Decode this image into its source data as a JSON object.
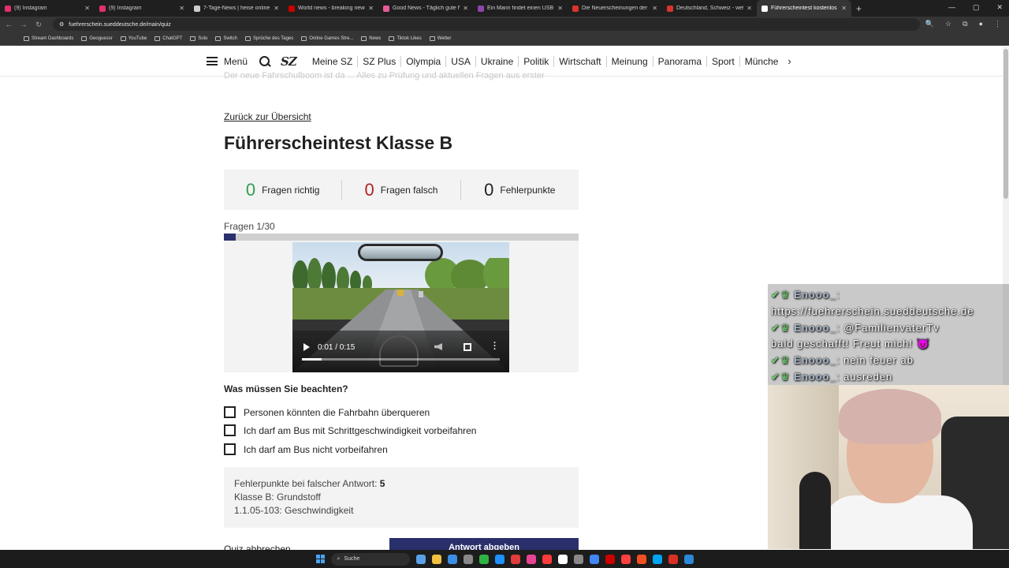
{
  "browser": {
    "tabs": [
      {
        "label": "(9) Instagram",
        "color": "#e1306c"
      },
      {
        "label": "(9) Instagram",
        "color": "#e1306c"
      },
      {
        "label": "7-Tage-News | heise online",
        "color": "#cccccc"
      },
      {
        "label": "World news - breaking news, vi",
        "color": "#cc0000"
      },
      {
        "label": "Good News - Täglich gute Nach",
        "color": "#e85a9a"
      },
      {
        "label": "Ein Mann findet einen USB-Stic",
        "color": "#8e44ad"
      },
      {
        "label": "Die Neuerscheinungen der Wo",
        "color": "#d9342b"
      },
      {
        "label": "Deutschland, Schweiz - wetter.",
        "color": "#d9342b"
      },
      {
        "label": "Führerscheintest kostenlos onli",
        "color": "#ffffff"
      }
    ],
    "active_tab_index": 8,
    "new_tab": "+",
    "url": "fuehrerschein.sueddeutsche.de/main/quiz",
    "bookmarks": [
      "Stream Dashboards",
      "Geoguessr",
      "YouTube",
      "ChatGPT",
      "Solo",
      "Switch",
      "Sprüche des Tages",
      "Online Games Stre...",
      "News",
      "Tiktok Likes",
      "Wetter"
    ]
  },
  "sz_nav": {
    "menu_label": "Menü",
    "logo": "SZ",
    "links": [
      "Meine SZ",
      "SZ Plus",
      "Olympia",
      "USA",
      "Ukraine",
      "Politik",
      "Wirtschaft",
      "Meinung",
      "Panorama",
      "Sport",
      "Münche"
    ]
  },
  "quiz": {
    "cutoff_text": "Der neue Fahrschulboom ist da ... Alles zu Prüfung und aktuellen Fragen aus erster",
    "back_link": "Zurück zur Übersicht",
    "title": "Führerscheintest Klasse B",
    "score": {
      "correct_value": "0",
      "correct_label": "Fragen richtig",
      "correct_color": "#2e9e4f",
      "wrong_value": "0",
      "wrong_label": "Fragen falsch",
      "wrong_color": "#b22222",
      "points_value": "0",
      "points_label": "Fehlerpunkte",
      "points_color": "#222222"
    },
    "progress_label": "Fragen 1/30",
    "progress_fraction": 0.0333,
    "video": {
      "time": "0:01 / 0:15",
      "played_fraction": 0.1
    },
    "question": "Was müssen Sie beachten?",
    "answers": [
      "Personen könnten die Fahrbahn überqueren",
      "Ich darf am Bus mit Schrittgeschwindigkeit vorbeifahren",
      "Ich darf am Bus nicht vorbeifahren"
    ],
    "info": {
      "points_prefix": "Fehlerpunkte bei falscher Antwort: ",
      "points_value": "5",
      "class_line": "Klasse B: Grundstoff",
      "code_line": "1.1.05-103: Geschwindigkeit"
    },
    "abort_label": "Quiz abbrechen",
    "submit_label": "Antwort abgeben"
  },
  "chat": {
    "lines": [
      {
        "user": "Enooo_",
        "text": ":"
      },
      {
        "user": "",
        "text": "https://fuehrerschein.sueddeutsche.de"
      },
      {
        "user": "Enooo_",
        "text": ": @FamilienvaterTv"
      },
      {
        "user": "",
        "text": "bald geschafft! Freut mich! 😈"
      },
      {
        "user": "Enooo_",
        "text": ": nein feuer ab"
      },
      {
        "user": "Enooo_",
        "text": ": ausreden"
      }
    ]
  },
  "taskbar": {
    "search_label": "Suche",
    "icons": [
      "#5aa0e6",
      "#f0c040",
      "#3a8ee6",
      "#888888",
      "#2fb344",
      "#1e90ff",
      "#e23b3b",
      "#e84393",
      "#ff3b3b",
      "#ffffff",
      "#888888",
      "#4285f4",
      "#cc0000",
      "#ff4040",
      "#f25022",
      "#00a4ef",
      "#d93025",
      "#2b88d8"
    ]
  }
}
